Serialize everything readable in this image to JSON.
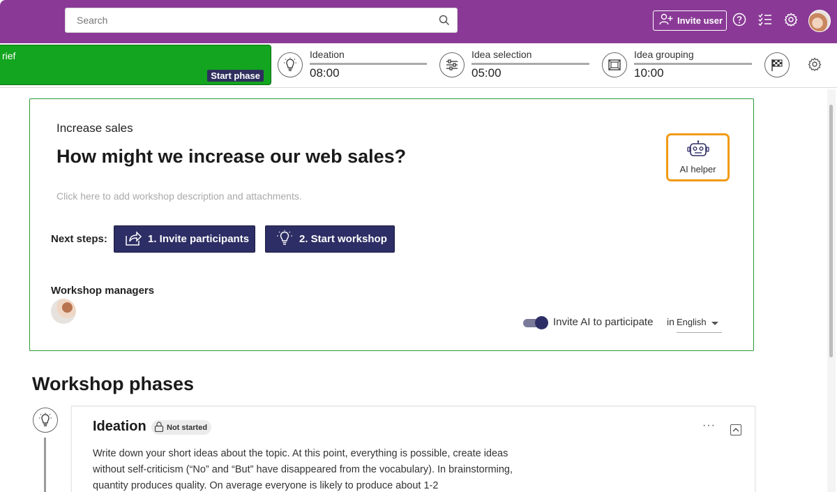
{
  "header": {
    "search_placeholder": "Search",
    "invite_label": "Invite user",
    "accent_color": "#8a3a96"
  },
  "phasebar": {
    "brief_title": "rief",
    "start_phase_label": "Start phase",
    "phases": [
      {
        "name": "Ideation",
        "time": "08:00"
      },
      {
        "name": "Idea selection",
        "time": "05:00"
      },
      {
        "name": "Idea grouping",
        "time": "10:00"
      }
    ]
  },
  "workshop": {
    "subtitle": "Increase sales",
    "question": "How might we increase our web sales?",
    "description_placeholder": "Click here to add workshop description and attachments.",
    "ai_helper_label": "AI helper",
    "next_steps_label": "Next steps:",
    "step1_label": "1. Invite participants",
    "step2_label": "2. Start workshop",
    "managers_label": "Workshop managers",
    "invite_ai_label": "Invite AI to participate",
    "invite_ai_enabled": true,
    "lang_prefix": "in",
    "lang_selected": "English"
  },
  "phases_section": {
    "title": "Workshop phases",
    "first_phase": {
      "title": "Ideation",
      "status": "Not started",
      "more_label": "···",
      "description": "Write down your short ideas about the topic. At this point, everything is possible, create ideas without self-criticism (“No” and “But” have disappeared from the vocabulary). In brainstorming, quantity produces quality. On average everyone is likely to produce about 1-2"
    }
  }
}
